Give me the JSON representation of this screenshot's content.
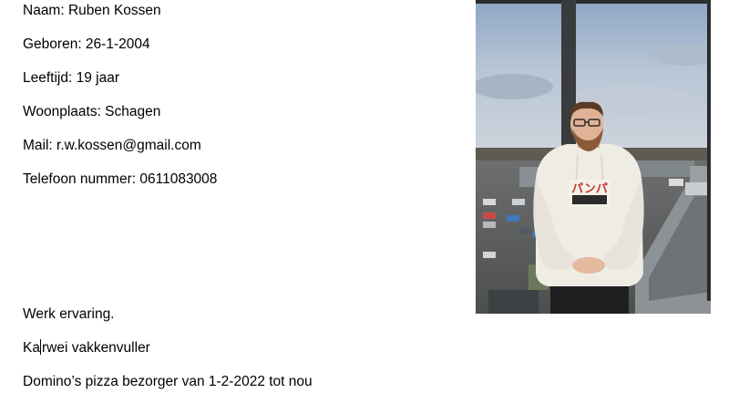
{
  "personal": {
    "name": "Naam: Ruben Kossen",
    "born": "Geboren: 26-1-2004",
    "age": "Leeftijd: 19 jaar",
    "residence": "Woonplaats: Schagen",
    "mail": "Mail: r.w.kossen@gmail.com",
    "phone": "Telefoon nummer: 0611083008"
  },
  "experience": {
    "heading": "Werk ervaring.",
    "job1_part1": "Ka",
    "job1_part2": "rwei vakkenvuller",
    "job2": "Domino’s pizza bezorger van 1-2-2022 tot nou"
  },
  "photo": {
    "subject": "person in white hoodie standing at window",
    "hoodie_print": "パンパ"
  }
}
